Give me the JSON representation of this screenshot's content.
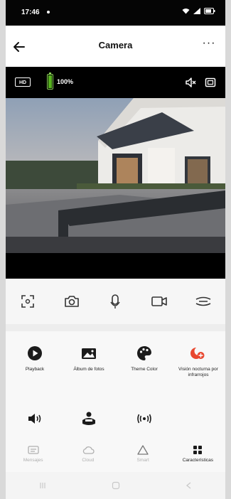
{
  "status": {
    "time": "17:46"
  },
  "header": {
    "title": "Camera",
    "more": "···"
  },
  "camera_bar": {
    "quality": "HD",
    "battery_percent": 100,
    "battery_text": "100%"
  },
  "features": [
    {
      "id": "playback",
      "label": "Playback"
    },
    {
      "id": "album",
      "label": "Álbum de fotos"
    },
    {
      "id": "theme",
      "label": "Theme Color"
    },
    {
      "id": "night",
      "label": "Visión nocturna por infrarrojos"
    },
    {
      "id": "volume",
      "label": ""
    },
    {
      "id": "detection",
      "label": ""
    },
    {
      "id": "wireless",
      "label": ""
    }
  ],
  "tabs": [
    {
      "id": "messages",
      "label": "Mensajes"
    },
    {
      "id": "cloud",
      "label": "Cloud"
    },
    {
      "id": "smart",
      "label": "Smart"
    },
    {
      "id": "features",
      "label": "Características"
    }
  ],
  "colors": {
    "accent": "#e8472f",
    "battery": "#56b21e",
    "dark": "#000000"
  }
}
